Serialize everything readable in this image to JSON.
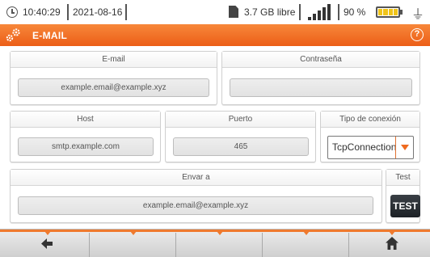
{
  "status_bar": {
    "time": "10:40:29",
    "date": "2021-08-16",
    "storage": "3.7 GB libre",
    "battery": "90 %"
  },
  "title_bar": {
    "title": "E-MAIL",
    "help_label": "?"
  },
  "form": {
    "email": {
      "label": "E-mail",
      "value": "example.email@example.xyz"
    },
    "password": {
      "label": "Contraseña",
      "value": ""
    },
    "host": {
      "label": "Host",
      "value": "smtp.example.com"
    },
    "port": {
      "label": "Puerto",
      "value": "465"
    },
    "connection_type": {
      "label": "Tipo de conexión",
      "value": "TcpConnection"
    },
    "send_to": {
      "label": "Envar a",
      "value": "example.email@example.xyz"
    },
    "test": {
      "label": "Test",
      "button_label": "TEST"
    }
  },
  "bottom_bar": {
    "back_icon": "arrow-left-icon",
    "home_icon": "home-icon"
  },
  "colors": {
    "accent": "#ef6a1f",
    "test_button": "#2a2e33"
  }
}
